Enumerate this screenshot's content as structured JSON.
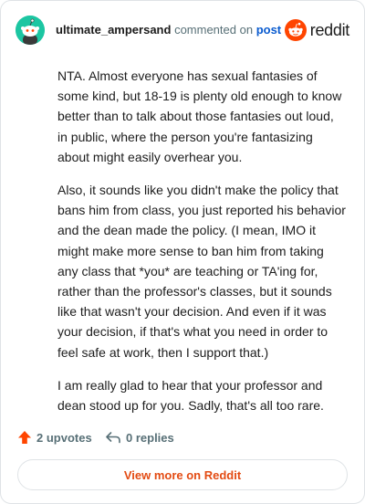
{
  "header": {
    "username": "ultimate_ampersand",
    "action": "commented on",
    "link": "post",
    "brand": "reddit"
  },
  "comment": {
    "paragraphs": [
      "NTA. Almost everyone has sexual fantasies of some kind, but 18-19 is plenty old enough to know better than to talk about those fantasies out loud, in public, where the person you're fantasizing about might easily overhear you.",
      "Also, it sounds like you didn't make the policy that bans him from class, you just reported his behavior and the dean made the policy. (I mean, IMO it might make more sense to ban him from taking any class that *you* are teaching or TA'ing for, rather than the professor's classes, but it sounds like that wasn't your decision. And even if it was your decision, if that's what you need in order to feel safe at work, then I support that.)",
      "I am really glad to hear that your professor and dean stood up for you. Sadly, that's all too rare."
    ]
  },
  "footer": {
    "upvotes": "2 upvotes",
    "replies": "0 replies",
    "view_more": "View more on Reddit"
  },
  "icons": {
    "avatar": "snoo-avatar-icon",
    "brand": "reddit-logo-icon",
    "upvote": "upvote-arrow-icon",
    "reply": "reply-arrow-icon"
  },
  "colors": {
    "accent": "#ff4500",
    "avatar_bg": "#1cc6a2",
    "link": "#0a5bcf",
    "view_more": "#e34b13"
  }
}
